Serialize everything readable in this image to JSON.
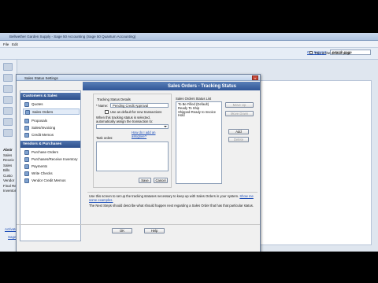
{
  "app": {
    "title": "Bellwether Garden Supply - Sage 50 Accounting (Sage 50 Quantum Accounting)",
    "menu": [
      "File",
      "Edit"
    ],
    "search_link": "Get Support",
    "search_placeholder": "search page"
  },
  "background": {
    "default_page_label": "This is the default page",
    "sidebar_labels": [
      "Abstr",
      "Sales",
      "Receiv",
      "Sales",
      "Bills",
      "Custo",
      "Vendor",
      "Final Re",
      "Inventor"
    ],
    "activate_link": "Activate Sage Payments",
    "notif_link": "Sage notifications (0)"
  },
  "dialog": {
    "window_title": "Sales Status Settings",
    "header": "Sales Orders - Tracking Status",
    "close_glyph": "x",
    "nav": {
      "customers_section": "Customers & Sales",
      "vendors_section": "Vendors & Purchases",
      "customer_items": [
        "Quotes",
        "Sales Orders",
        "Proposals",
        "Sales/Invoicing",
        "Credit Memos"
      ],
      "vendor_items": [
        "Purchase Orders",
        "Purchases/Receive Inventory",
        "Payments",
        "Write Checks",
        "Vendor Credit Memos"
      ]
    },
    "detail": {
      "section_title": "Tracking Status Details",
      "name_label": "* Name:",
      "name_value": "Pending Credit Approval",
      "use_default_label": "Use as default for new transactions",
      "assign_label": "When this tracking status is selected, automatically assign the transaction to:",
      "assign_value": "",
      "how_link": "How do I add an assignee?",
      "task_label": "Task ordes:",
      "save_label": "Save",
      "cancel_label": "Cancel"
    },
    "status_list": {
      "title": "Sales Orders Status List",
      "items": [
        "To Be Filled (Default)",
        "Ready To Ship",
        "Shipped-Ready to Invoice",
        "Hold"
      ]
    },
    "side_buttons": {
      "move_up": "Move Up",
      "move_down": "Move Down",
      "add": "Add",
      "delete": "Delete"
    },
    "info_text_1": "Use this screen to set up the tracking statuses necessary to keep up with Sales Orders in your system.",
    "info_link": "Show me some examples.",
    "info_text_2": "The Next Steps should describe what should happen next regarding a Sales Order that has that particular status.",
    "ok_label": "OK",
    "help_label": "Help"
  }
}
